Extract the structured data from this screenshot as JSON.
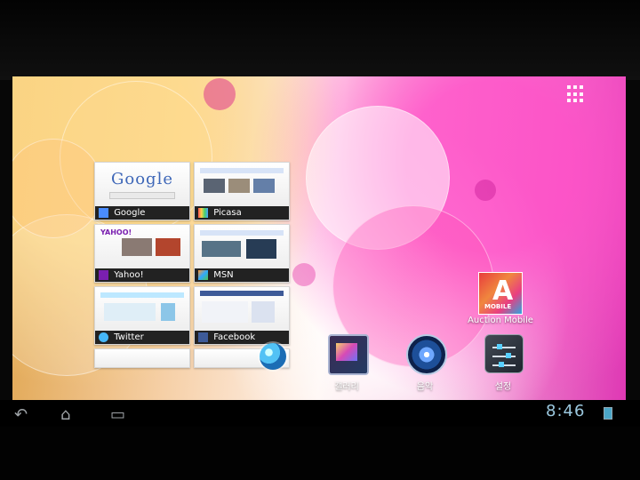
{
  "bookmarks": [
    {
      "label": "Google",
      "icon": "google-icon"
    },
    {
      "label": "Picasa",
      "icon": "picasa-icon"
    },
    {
      "label": "Yahoo!",
      "icon": "yahoo-icon"
    },
    {
      "label": "MSN",
      "icon": "msn-icon"
    },
    {
      "label": "Twitter",
      "icon": "twitter-icon"
    },
    {
      "label": "Facebook",
      "icon": "facebook-icon"
    }
  ],
  "thumbnails": {
    "google_word": "Google",
    "yahoo_word": "YAHOO!"
  },
  "apps": {
    "auction": {
      "letter": "A",
      "badge": "MOBILE",
      "label": "Auction Mobile"
    },
    "gallery": {
      "label": "갤러리"
    },
    "music": {
      "label": "음악"
    },
    "settings": {
      "label": "설정"
    }
  },
  "status": {
    "clock": "8:46"
  },
  "nav": {
    "back_icon": "back-icon",
    "home_icon": "home-icon",
    "recent_icon": "recent-apps-icon"
  },
  "colors": {
    "clock": "#9bc8df",
    "wallpaper_pink": "#df38b4",
    "wallpaper_orange": "#e0a54f"
  }
}
